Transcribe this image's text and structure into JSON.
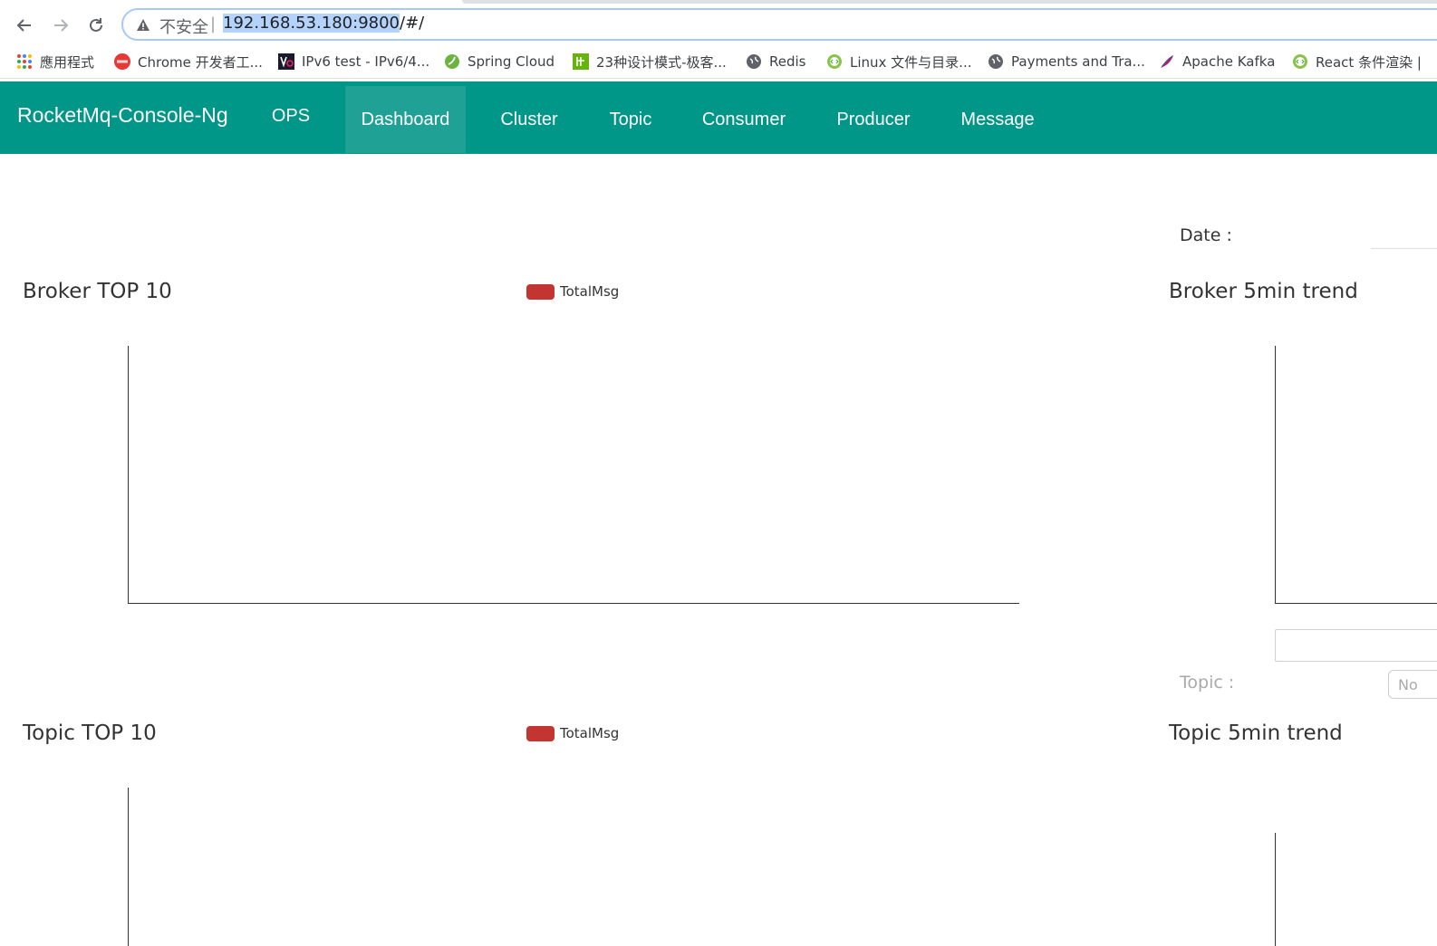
{
  "browser": {
    "security_label": "不安全",
    "url_separator": "|",
    "url_host": "192.168.53.180:9800",
    "url_path": "/#/",
    "bookmarks": [
      {
        "label": "應用程式",
        "icon": "apps-grid-icon"
      },
      {
        "label": "Chrome 开发者工...",
        "icon": "html-icon"
      },
      {
        "label": "IPv6 test - IPv6/4...",
        "icon": "ipv6-icon"
      },
      {
        "label": "Spring Cloud",
        "icon": "spring-leaf-icon"
      },
      {
        "label": "23种设计模式-极客...",
        "icon": "geek-icon"
      },
      {
        "label": "Redis",
        "icon": "globe-icon"
      },
      {
        "label": "Linux 文件与目录...",
        "icon": "code-icon"
      },
      {
        "label": "Payments and Tra...",
        "icon": "globe-icon"
      },
      {
        "label": "Apache Kafka",
        "icon": "feather-icon"
      },
      {
        "label": "React 条件渲染 |",
        "icon": "code-icon"
      }
    ]
  },
  "navbar": {
    "brand": "RocketMq-Console-Ng",
    "items": [
      {
        "label": "OPS",
        "active": false
      },
      {
        "label": "Dashboard",
        "active": true
      },
      {
        "label": "Cluster",
        "active": false
      },
      {
        "label": "Topic",
        "active": false
      },
      {
        "label": "Consumer",
        "active": false
      },
      {
        "label": "Producer",
        "active": false
      },
      {
        "label": "Message",
        "active": false
      }
    ],
    "color": "#009688",
    "active_color": "#1fa295"
  },
  "dashboard": {
    "date_label": "Date :",
    "topic_label": "Topic :",
    "topic_select_placeholder": "No",
    "broker_top_title": "Broker TOP 10",
    "broker_trend_title": "Broker 5min trend",
    "topic_top_title": "Topic TOP 10",
    "topic_trend_title": "Topic 5min trend",
    "legend_color": "#c23531"
  },
  "chart_data": [
    {
      "type": "bar",
      "title": "Broker TOP 10",
      "series": [
        {
          "name": "TotalMsg",
          "values": []
        }
      ],
      "categories": []
    },
    {
      "type": "line",
      "title": "Broker 5min trend",
      "series": [],
      "x": []
    },
    {
      "type": "bar",
      "title": "Topic TOP 10",
      "series": [
        {
          "name": "TotalMsg",
          "values": []
        }
      ],
      "categories": []
    },
    {
      "type": "line",
      "title": "Topic 5min trend",
      "series": [],
      "x": []
    }
  ]
}
